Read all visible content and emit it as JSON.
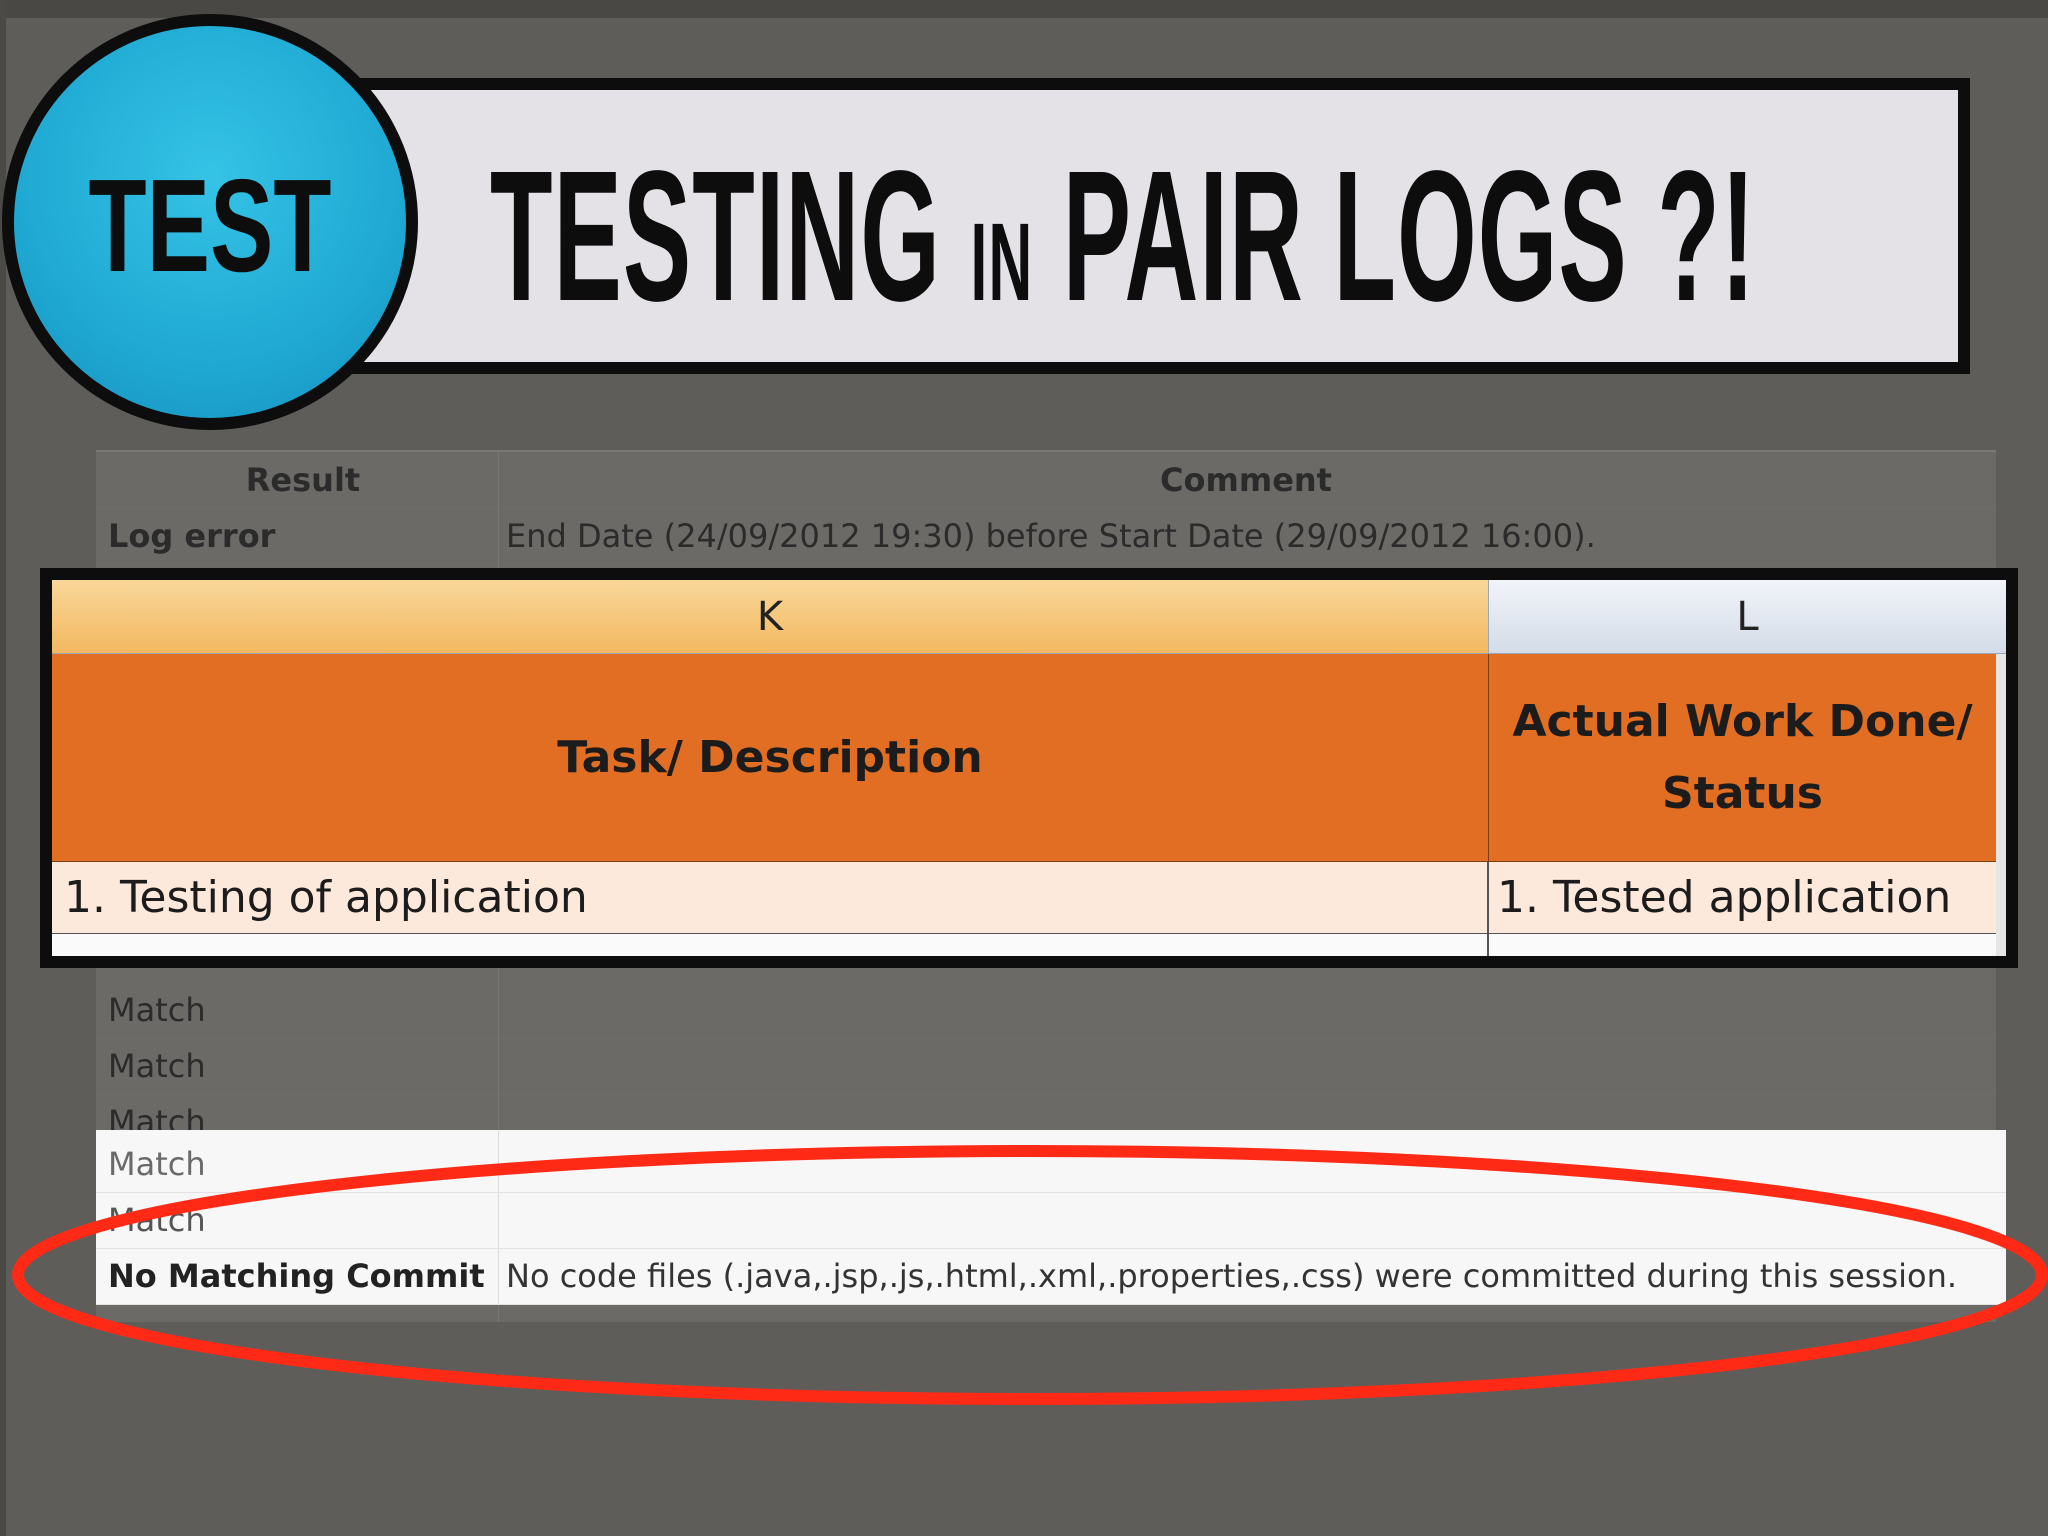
{
  "colors": {
    "badge_blue": "#1fa9d3",
    "banner_bg": "#e4e2e7",
    "outline": "#0d0d0d",
    "header_orange": "#e16e22",
    "highlight_red": "#ff2a16"
  },
  "badge": {
    "label": "TEST"
  },
  "banner": {
    "title_part1": "TESTING ",
    "title_small": "IN",
    "title_part2": " PAIR LOGS ?!"
  },
  "results_sheet": {
    "headers": {
      "result": "Result",
      "comment": "Comment"
    },
    "rows": [
      {
        "result": "Log error",
        "comment": "End Date (24/09/2012 19:30) before Start Date (29/09/2012 16:00)."
      },
      {
        "result": "Match",
        "comment": ""
      },
      {
        "result": "Match",
        "comment": ""
      },
      {
        "result": "Match",
        "comment": ""
      },
      {
        "result": "Match",
        "comment": ""
      },
      {
        "result": "Match",
        "comment": ""
      },
      {
        "result": "No Matching Commit",
        "comment": "No code files (.java,.jsp,.js,.html,.xml,.properties,.css) were committed during this session."
      }
    ]
  },
  "excel_zoom": {
    "column_k": "K",
    "column_l": "L",
    "header_task": "Task/ Description",
    "header_status": "Actual Work Done/ Status",
    "row_task": "1. Testing of application",
    "row_status": "1. Tested application"
  }
}
